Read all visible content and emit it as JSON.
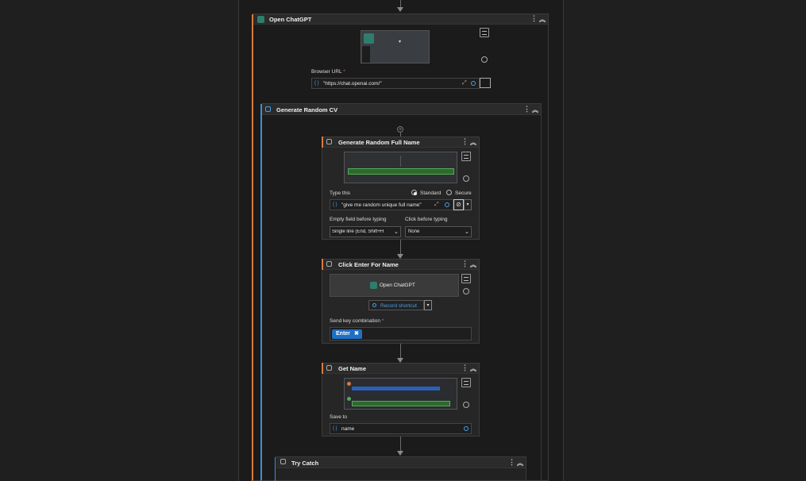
{
  "steps": {
    "open_chatgpt": {
      "title": "Open ChatGPT",
      "browser_url_label": "Browser URL",
      "required_mark": "*",
      "browser_url_value": "\"https://chat.openai.com/\""
    },
    "generate_cv": {
      "title": "Generate Random CV"
    },
    "random_name": {
      "title": "Generate Random Full Name",
      "type_this_label": "Type this",
      "standard_label": "Standard",
      "secure_label": "Secure",
      "type_value": "\"give me random unique full name\"",
      "empty_field_label": "Empty field before typing",
      "empty_field_value": "Single line (End, Shift+H",
      "click_before_label": "Click before typing",
      "click_before_value": "None"
    },
    "click_enter": {
      "title": "Click Enter For Name",
      "target_label": "Open ChatGPT",
      "record_label": "Record shortcut",
      "send_key_label": "Send key combination",
      "required_mark": "*",
      "key_value": "Enter"
    },
    "get_name": {
      "title": "Get Name",
      "save_to_label": "Save to",
      "save_to_value": "name"
    },
    "try_catch": {
      "title": "Try Catch"
    }
  },
  "colors": {
    "accent_orange": "#d97a3d",
    "accent_blue": "#3d8fd9",
    "brace_blue": "#4a9ee8",
    "pill_blue": "#1f6fc4"
  }
}
